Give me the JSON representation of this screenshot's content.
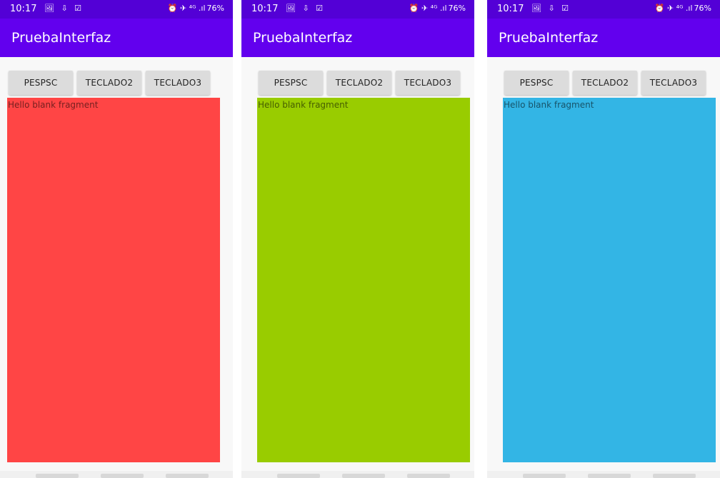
{
  "status_bar": {
    "time": "10:17",
    "left_icons": "🖼 ⇩ ☑",
    "right_icons": "⏰ ✈ ⁴ᴳ .ıl",
    "battery": "76%"
  },
  "app": {
    "title": "PruebaInterfaz"
  },
  "buttons": {
    "pespsc": "PESPSC",
    "teclado2": "TECLADO2",
    "teclado3": "TECLADO3"
  },
  "fragment": {
    "text": "Hello blank fragment"
  },
  "colors": {
    "status_bar": "#5300d6",
    "app_bar": "#6200ee",
    "fragment_1": "#ff4545",
    "fragment_2": "#99cc00",
    "fragment_3": "#33b5e5"
  }
}
